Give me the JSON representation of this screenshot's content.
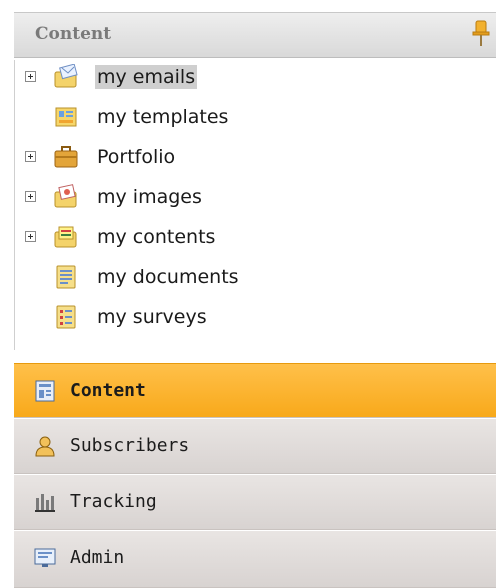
{
  "header": {
    "title": "Content",
    "pin_icon": "pin-icon"
  },
  "tree": {
    "items": [
      {
        "label": "my emails",
        "icon": "email-folder-icon",
        "expandable": true,
        "selected": true
      },
      {
        "label": "my templates",
        "icon": "templates-icon",
        "expandable": false
      },
      {
        "label": "Portfolio",
        "icon": "briefcase-icon",
        "expandable": true
      },
      {
        "label": "my images",
        "icon": "images-icon",
        "expandable": true
      },
      {
        "label": "my contents",
        "icon": "contents-icon",
        "expandable": true
      },
      {
        "label": "my documents",
        "icon": "documents-icon",
        "expandable": false
      },
      {
        "label": "my surveys",
        "icon": "surveys-icon",
        "expandable": false
      }
    ]
  },
  "nav": {
    "items": [
      {
        "label": "Content",
        "icon": "content-icon",
        "active": true
      },
      {
        "label": "Subscribers",
        "icon": "subscribers-icon",
        "active": false
      },
      {
        "label": "Tracking",
        "icon": "tracking-icon",
        "active": false
      },
      {
        "label": "Admin",
        "icon": "admin-icon",
        "active": false
      }
    ]
  },
  "colors": {
    "active_nav": "#f8a91a",
    "inactive_nav": "#ddd8d6",
    "header": "#e3e3e3"
  }
}
